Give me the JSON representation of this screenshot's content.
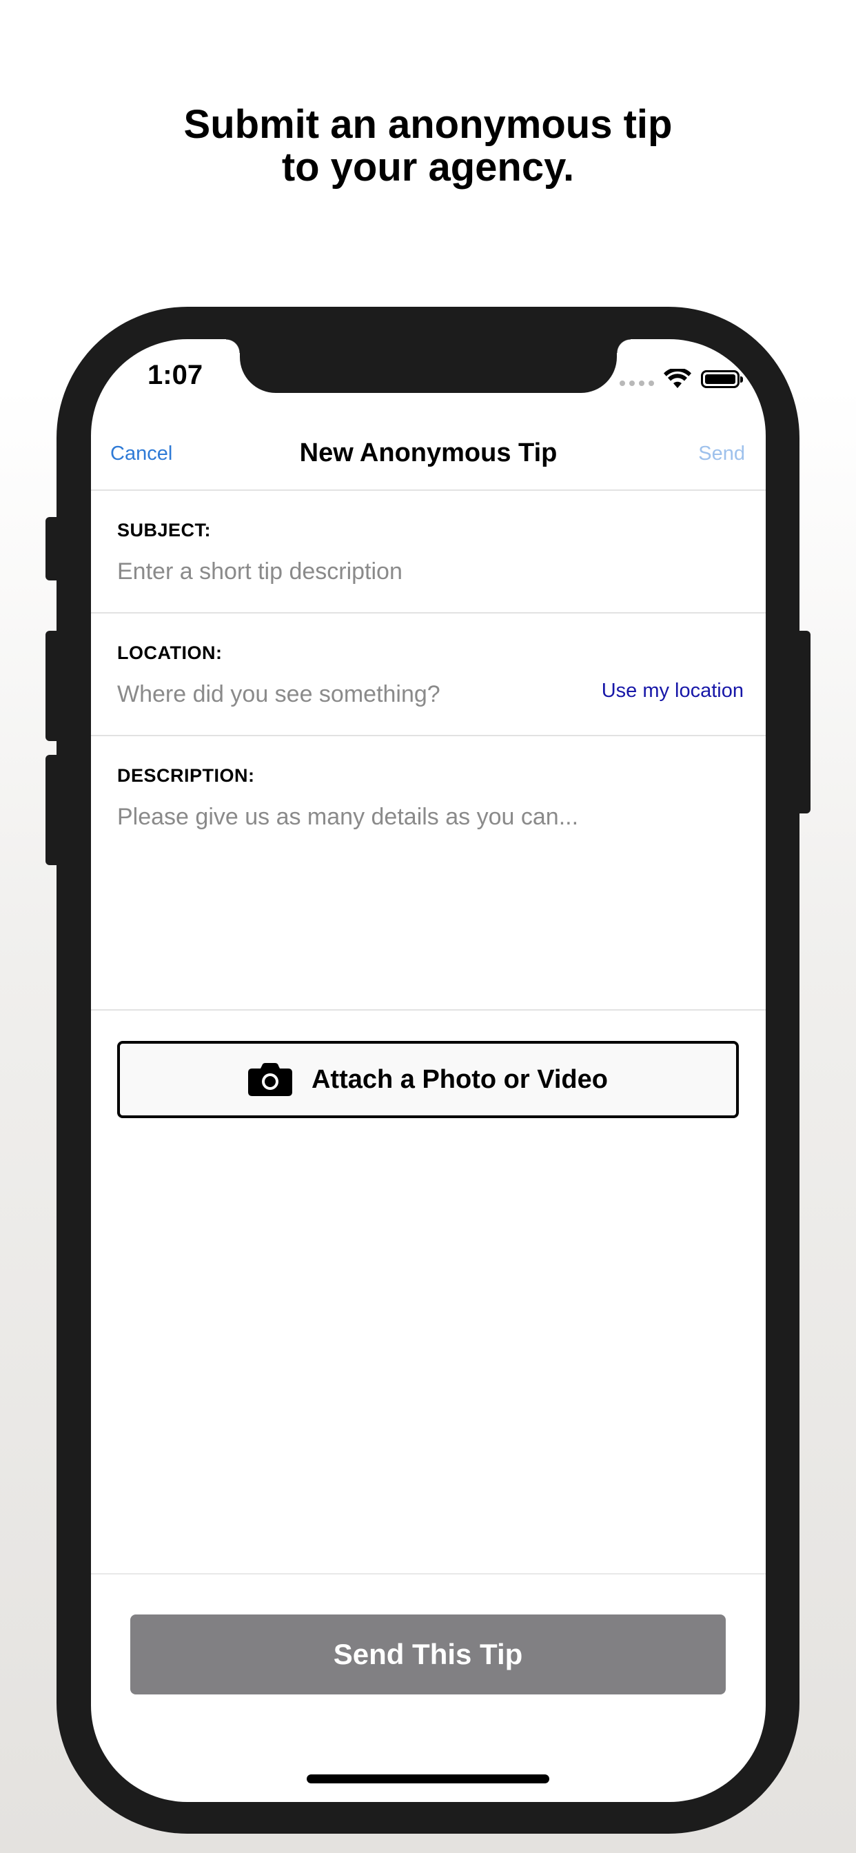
{
  "headline": {
    "line1": "Submit an anonymous tip",
    "line2": "to your agency."
  },
  "status_bar": {
    "time": "1:07",
    "icons": [
      "signal-dots-icon",
      "wifi-icon",
      "battery-icon"
    ]
  },
  "nav": {
    "cancel_label": "Cancel",
    "title": "New Anonymous Tip",
    "send_label": "Send"
  },
  "form": {
    "subject": {
      "label": "SUBJECT:",
      "placeholder": "Enter a short tip description"
    },
    "location": {
      "label": "LOCATION:",
      "placeholder": "Where did you see something?",
      "action_label": "Use my location"
    },
    "description": {
      "label": "DESCRIPTION:",
      "placeholder": "Please give us as many details as you can..."
    }
  },
  "attach": {
    "label": "Attach a Photo or Video",
    "icon": "camera-icon"
  },
  "submit": {
    "label": "Send This Tip"
  },
  "colors": {
    "link_blue": "#2e7ad6",
    "send_disabled": "#9ec1ec",
    "location_link": "#1717a8",
    "submit_disabled_bg": "#818083",
    "phone_frame": "#1c1c1c"
  }
}
